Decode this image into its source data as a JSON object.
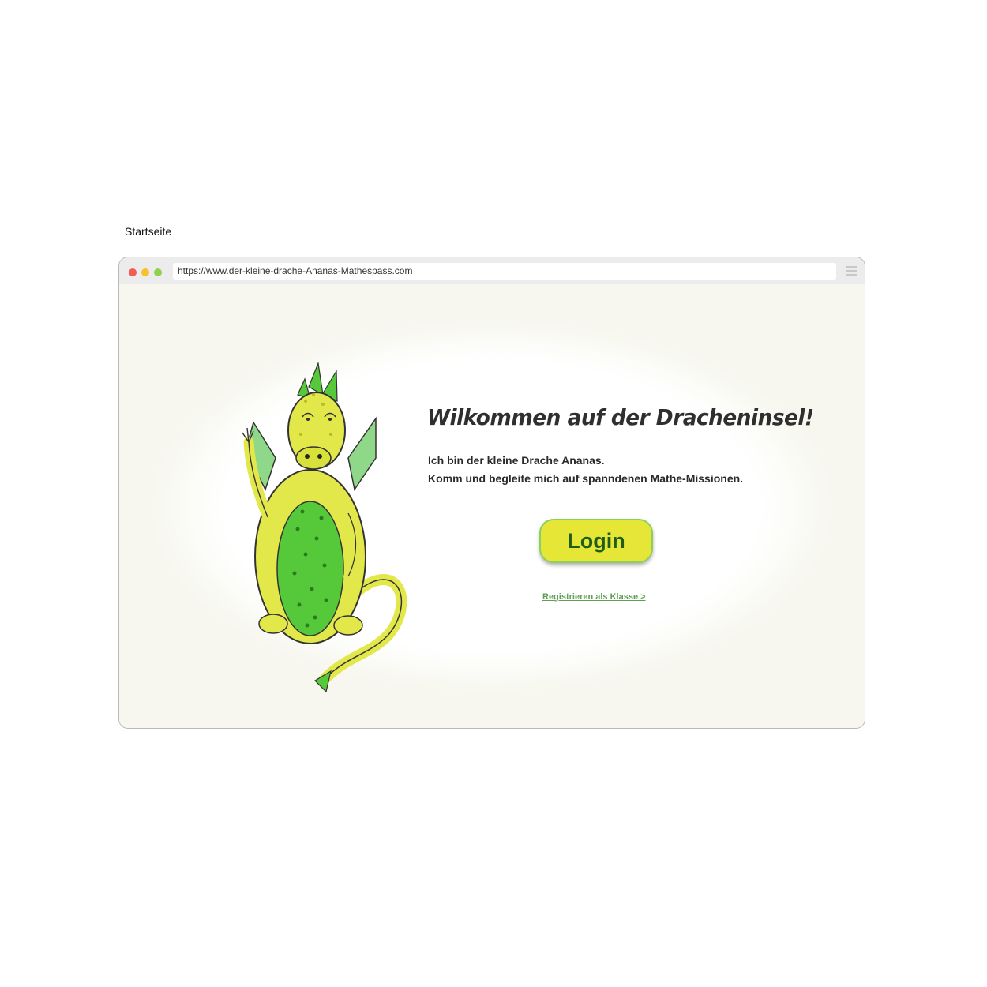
{
  "page": {
    "label": "Startseite"
  },
  "browser": {
    "url": "https://www.der-kleine-drache-Ananas-Mathespass.com",
    "menu_icon": "hamburger-menu-icon"
  },
  "main": {
    "headline": "Wilkommen auf der Dracheninsel!",
    "intro_lines": [
      "Ich bin der kleine Drache Ananas.",
      "Komm und begleite mich auf spanndenen Mathe-Missionen."
    ],
    "login_label": "Login",
    "register_link": "Registrieren als Klasse >"
  },
  "colors": {
    "button_fill": "#e6e637",
    "button_border": "#8ccf5e",
    "button_text": "#1f5e1a",
    "link": "#5f9e53",
    "dragon_body": "#e3e84a",
    "dragon_belly": "#56c93a",
    "dragon_wings": "#8fd88a"
  }
}
